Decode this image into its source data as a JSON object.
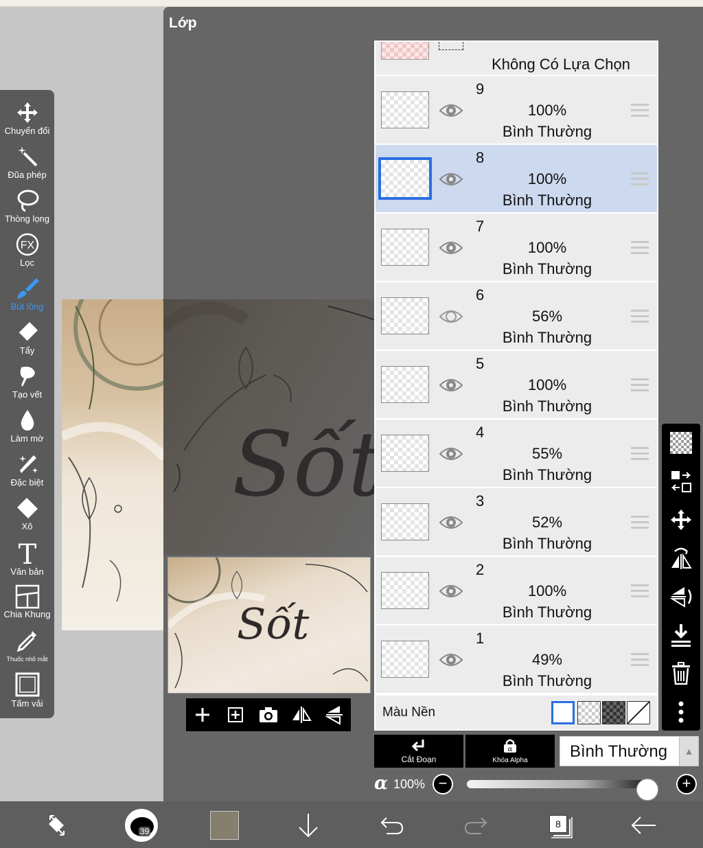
{
  "panel": {
    "title": "Lớp"
  },
  "tools": [
    {
      "label": "Chuyển đổi",
      "icon": "move-icon"
    },
    {
      "label": "Đũa phép",
      "icon": "magic-wand-icon"
    },
    {
      "label": "Thòng lọng",
      "icon": "lasso-icon"
    },
    {
      "label": "Lọc",
      "icon": "fx-icon",
      "glyph": "FX"
    },
    {
      "label": "Bút lông",
      "icon": "brush-icon",
      "active": true
    },
    {
      "label": "Tẩy",
      "icon": "eraser-icon"
    },
    {
      "label": "Tạo vết",
      "icon": "smudge-icon"
    },
    {
      "label": "Làm mờ",
      "icon": "blur-drop-icon"
    },
    {
      "label": "Đặc biệt",
      "icon": "special-pen-icon"
    },
    {
      "label": "Xô",
      "icon": "bucket-icon"
    },
    {
      "label": "Văn bản",
      "icon": "text-icon",
      "glyph": "T"
    },
    {
      "label": "Chia Khung",
      "icon": "frame-divider-icon"
    },
    {
      "label": "Thuốc nhỏ mắt",
      "icon": "eyedropper-icon"
    },
    {
      "label": "Tấm vải",
      "icon": "canvas-icon"
    }
  ],
  "canvas_preview": {
    "script_text": "Sốt"
  },
  "selection_row": {
    "label": "Không Có Lựa Chọn"
  },
  "layers": [
    {
      "number": "9",
      "opacity": "100%",
      "blend": "Bình Thường",
      "visible": true,
      "selected": false
    },
    {
      "number": "8",
      "opacity": "100%",
      "blend": "Bình Thường",
      "visible": true,
      "selected": true
    },
    {
      "number": "7",
      "opacity": "100%",
      "blend": "Bình Thường",
      "visible": true,
      "selected": false
    },
    {
      "number": "6",
      "opacity": "56%",
      "blend": "Bình Thường",
      "visible": false,
      "selected": false
    },
    {
      "number": "5",
      "opacity": "100%",
      "blend": "Bình Thường",
      "visible": true,
      "selected": false
    },
    {
      "number": "4",
      "opacity": "55%",
      "blend": "Bình Thường",
      "visible": true,
      "selected": false
    },
    {
      "number": "3",
      "opacity": "52%",
      "blend": "Bình Thường",
      "visible": true,
      "selected": false
    },
    {
      "number": "2",
      "opacity": "100%",
      "blend": "Bình Thường",
      "visible": true,
      "selected": false
    },
    {
      "number": "1",
      "opacity": "49%",
      "blend": "Bình Thường",
      "visible": true,
      "selected": false
    }
  ],
  "background": {
    "label": "Màu Nền"
  },
  "actions": {
    "clipping": "Cắt Đoạn",
    "alpha_lock": "Khóa Alpha",
    "blend_mode": "Bình Thường"
  },
  "opacity": {
    "symbol": "α",
    "value": "100%",
    "fraction": 1.0
  },
  "bottombar": {
    "brush_size": "39",
    "layer_count": "8",
    "color": "#867f6d"
  },
  "colors": {
    "accent": "#3d97ee",
    "selected_layer": "#ccd9ee",
    "selected_border": "#2a6ee0"
  }
}
